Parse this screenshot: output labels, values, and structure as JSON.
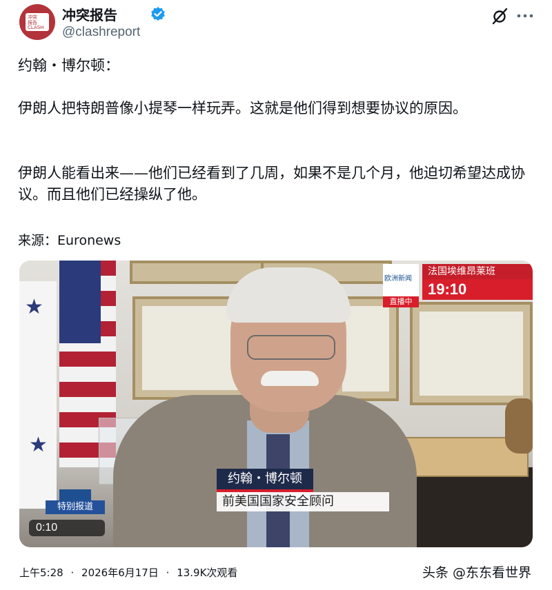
{
  "account": {
    "name": "冲突报告",
    "handle": "@clashreport",
    "verified": true,
    "avatar_text": [
      "冲突",
      "报告",
      "CLASH"
    ]
  },
  "actions": {
    "grok_icon": "grok-icon",
    "more_icon": "more-icon"
  },
  "post": {
    "heading": "约翰・博尔顿：",
    "paragraph1": "伊朗人把特朗普像小提琴一样玩弄。这就是他们得到想要协议的原因。",
    "paragraph2": "伊朗人能看出来——他们已经看到了几周，如果不是几个月，他迫切希望达成协议。而且他们已经操纵了他。",
    "source": "来源：Euronews"
  },
  "video": {
    "channel_label": "欧洲新闻",
    "live_label": "直播中",
    "location": "法国埃维昂莱班",
    "clock": "19:10",
    "special_label": "特别报道",
    "timecode": "0:10",
    "lower_third_name": "约翰・博尔顿",
    "lower_third_title": "前美国国家安全顾问",
    "colors": {
      "accent_red": "#d81e2b",
      "accent_blue": "#1d4f91"
    }
  },
  "meta": {
    "time": "上午5:28",
    "separator": "·",
    "date": "2026年6月17日",
    "views": "13.9K次观看"
  },
  "watermark": "头条 @东东看世界"
}
